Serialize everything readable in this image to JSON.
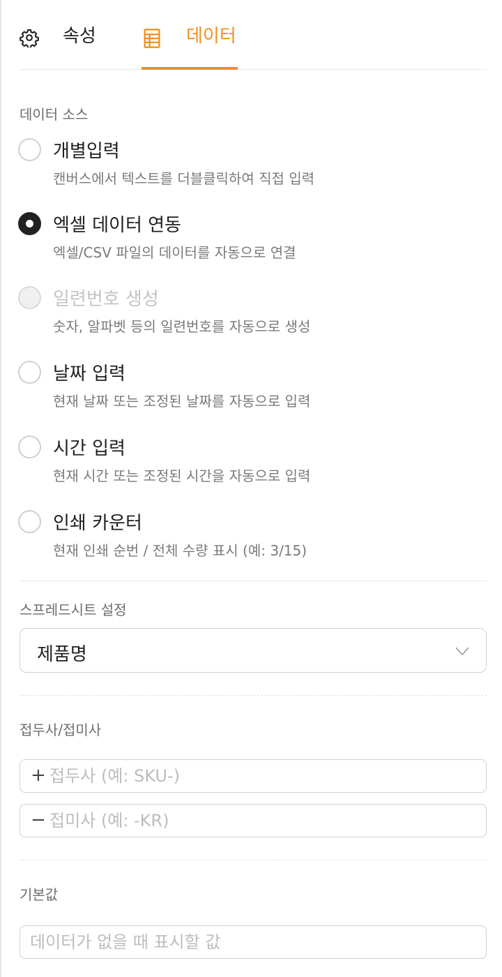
{
  "tabs": [
    {
      "label": "속성",
      "icon": "gear-icon",
      "active": false
    },
    {
      "label": "데이터",
      "icon": "data-sheet-icon",
      "active": true
    }
  ],
  "colors": {
    "accent": "#f0901e",
    "text": "#1f1f1f",
    "muted": "#7a7a7a"
  },
  "data_source": {
    "title": "데이터 소스",
    "options": [
      {
        "label": "개별입력",
        "desc": "캔버스에서 텍스트를 더블클릭하여 직접 입력",
        "checked": false,
        "disabled": false
      },
      {
        "label": "엑셀 데이터 연동",
        "desc": "엑셀/CSV 파일의 데이터를 자동으로 연결",
        "checked": true,
        "disabled": false
      },
      {
        "label": "일련번호 생성",
        "desc": "숫자, 알파벳 등의 일련번호를 자동으로 생성",
        "checked": false,
        "disabled": true
      },
      {
        "label": "날짜 입력",
        "desc": "현재 날짜 또는 조정된 날짜를 자동으로 입력",
        "checked": false,
        "disabled": false
      },
      {
        "label": "시간 입력",
        "desc": "현재 시간 또는 조정된 시간을 자동으로 입력",
        "checked": false,
        "disabled": false
      },
      {
        "label": "인쇄 카운터",
        "desc": "현재 인쇄 순번 / 전체 수량 표시 (예: 3/15)",
        "checked": false,
        "disabled": false
      }
    ]
  },
  "spreadsheet": {
    "title": "스프레드시트 설정",
    "selected": "제품명"
  },
  "affix": {
    "title": "접두사/접미사",
    "prefix_symbol": "+",
    "prefix_placeholder": "접두사 (예: SKU-)",
    "suffix_symbol": "−",
    "suffix_placeholder": "접미사 (예: -KR)"
  },
  "default_value": {
    "title": "기본값",
    "placeholder": "데이터가 없을 때 표시할 값"
  }
}
